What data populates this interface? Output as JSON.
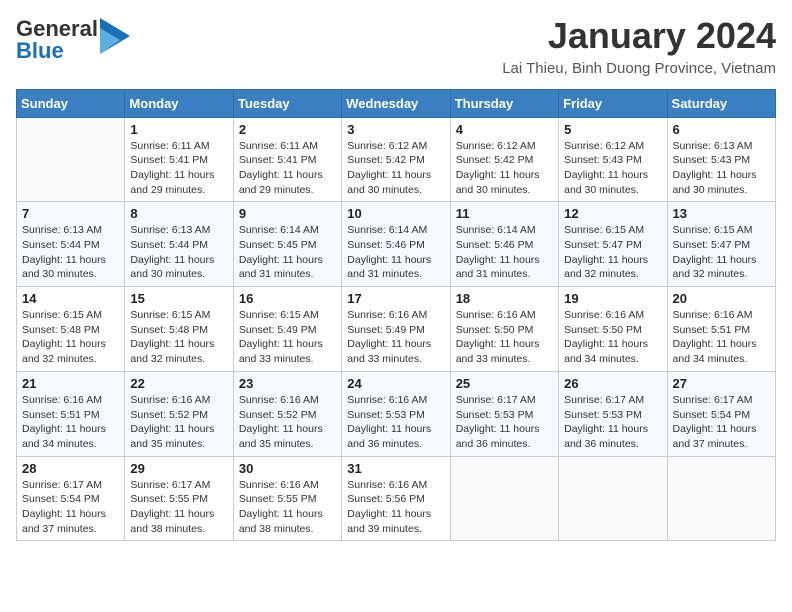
{
  "header": {
    "logo_general": "General",
    "logo_blue": "Blue",
    "month_title": "January 2024",
    "location": "Lai Thieu, Binh Duong Province, Vietnam"
  },
  "days_of_week": [
    "Sunday",
    "Monday",
    "Tuesday",
    "Wednesday",
    "Thursday",
    "Friday",
    "Saturday"
  ],
  "weeks": [
    [
      {
        "day": "",
        "sunrise": "",
        "sunset": "",
        "daylight": ""
      },
      {
        "day": "1",
        "sunrise": "Sunrise: 6:11 AM",
        "sunset": "Sunset: 5:41 PM",
        "daylight": "Daylight: 11 hours and 29 minutes."
      },
      {
        "day": "2",
        "sunrise": "Sunrise: 6:11 AM",
        "sunset": "Sunset: 5:41 PM",
        "daylight": "Daylight: 11 hours and 29 minutes."
      },
      {
        "day": "3",
        "sunrise": "Sunrise: 6:12 AM",
        "sunset": "Sunset: 5:42 PM",
        "daylight": "Daylight: 11 hours and 30 minutes."
      },
      {
        "day": "4",
        "sunrise": "Sunrise: 6:12 AM",
        "sunset": "Sunset: 5:42 PM",
        "daylight": "Daylight: 11 hours and 30 minutes."
      },
      {
        "day": "5",
        "sunrise": "Sunrise: 6:12 AM",
        "sunset": "Sunset: 5:43 PM",
        "daylight": "Daylight: 11 hours and 30 minutes."
      },
      {
        "day": "6",
        "sunrise": "Sunrise: 6:13 AM",
        "sunset": "Sunset: 5:43 PM",
        "daylight": "Daylight: 11 hours and 30 minutes."
      }
    ],
    [
      {
        "day": "7",
        "sunrise": "Sunrise: 6:13 AM",
        "sunset": "Sunset: 5:44 PM",
        "daylight": "Daylight: 11 hours and 30 minutes."
      },
      {
        "day": "8",
        "sunrise": "Sunrise: 6:13 AM",
        "sunset": "Sunset: 5:44 PM",
        "daylight": "Daylight: 11 hours and 30 minutes."
      },
      {
        "day": "9",
        "sunrise": "Sunrise: 6:14 AM",
        "sunset": "Sunset: 5:45 PM",
        "daylight": "Daylight: 11 hours and 31 minutes."
      },
      {
        "day": "10",
        "sunrise": "Sunrise: 6:14 AM",
        "sunset": "Sunset: 5:46 PM",
        "daylight": "Daylight: 11 hours and 31 minutes."
      },
      {
        "day": "11",
        "sunrise": "Sunrise: 6:14 AM",
        "sunset": "Sunset: 5:46 PM",
        "daylight": "Daylight: 11 hours and 31 minutes."
      },
      {
        "day": "12",
        "sunrise": "Sunrise: 6:15 AM",
        "sunset": "Sunset: 5:47 PM",
        "daylight": "Daylight: 11 hours and 32 minutes."
      },
      {
        "day": "13",
        "sunrise": "Sunrise: 6:15 AM",
        "sunset": "Sunset: 5:47 PM",
        "daylight": "Daylight: 11 hours and 32 minutes."
      }
    ],
    [
      {
        "day": "14",
        "sunrise": "Sunrise: 6:15 AM",
        "sunset": "Sunset: 5:48 PM",
        "daylight": "Daylight: 11 hours and 32 minutes."
      },
      {
        "day": "15",
        "sunrise": "Sunrise: 6:15 AM",
        "sunset": "Sunset: 5:48 PM",
        "daylight": "Daylight: 11 hours and 32 minutes."
      },
      {
        "day": "16",
        "sunrise": "Sunrise: 6:15 AM",
        "sunset": "Sunset: 5:49 PM",
        "daylight": "Daylight: 11 hours and 33 minutes."
      },
      {
        "day": "17",
        "sunrise": "Sunrise: 6:16 AM",
        "sunset": "Sunset: 5:49 PM",
        "daylight": "Daylight: 11 hours and 33 minutes."
      },
      {
        "day": "18",
        "sunrise": "Sunrise: 6:16 AM",
        "sunset": "Sunset: 5:50 PM",
        "daylight": "Daylight: 11 hours and 33 minutes."
      },
      {
        "day": "19",
        "sunrise": "Sunrise: 6:16 AM",
        "sunset": "Sunset: 5:50 PM",
        "daylight": "Daylight: 11 hours and 34 minutes."
      },
      {
        "day": "20",
        "sunrise": "Sunrise: 6:16 AM",
        "sunset": "Sunset: 5:51 PM",
        "daylight": "Daylight: 11 hours and 34 minutes."
      }
    ],
    [
      {
        "day": "21",
        "sunrise": "Sunrise: 6:16 AM",
        "sunset": "Sunset: 5:51 PM",
        "daylight": "Daylight: 11 hours and 34 minutes."
      },
      {
        "day": "22",
        "sunrise": "Sunrise: 6:16 AM",
        "sunset": "Sunset: 5:52 PM",
        "daylight": "Daylight: 11 hours and 35 minutes."
      },
      {
        "day": "23",
        "sunrise": "Sunrise: 6:16 AM",
        "sunset": "Sunset: 5:52 PM",
        "daylight": "Daylight: 11 hours and 35 minutes."
      },
      {
        "day": "24",
        "sunrise": "Sunrise: 6:16 AM",
        "sunset": "Sunset: 5:53 PM",
        "daylight": "Daylight: 11 hours and 36 minutes."
      },
      {
        "day": "25",
        "sunrise": "Sunrise: 6:17 AM",
        "sunset": "Sunset: 5:53 PM",
        "daylight": "Daylight: 11 hours and 36 minutes."
      },
      {
        "day": "26",
        "sunrise": "Sunrise: 6:17 AM",
        "sunset": "Sunset: 5:53 PM",
        "daylight": "Daylight: 11 hours and 36 minutes."
      },
      {
        "day": "27",
        "sunrise": "Sunrise: 6:17 AM",
        "sunset": "Sunset: 5:54 PM",
        "daylight": "Daylight: 11 hours and 37 minutes."
      }
    ],
    [
      {
        "day": "28",
        "sunrise": "Sunrise: 6:17 AM",
        "sunset": "Sunset: 5:54 PM",
        "daylight": "Daylight: 11 hours and 37 minutes."
      },
      {
        "day": "29",
        "sunrise": "Sunrise: 6:17 AM",
        "sunset": "Sunset: 5:55 PM",
        "daylight": "Daylight: 11 hours and 38 minutes."
      },
      {
        "day": "30",
        "sunrise": "Sunrise: 6:16 AM",
        "sunset": "Sunset: 5:55 PM",
        "daylight": "Daylight: 11 hours and 38 minutes."
      },
      {
        "day": "31",
        "sunrise": "Sunrise: 6:16 AM",
        "sunset": "Sunset: 5:56 PM",
        "daylight": "Daylight: 11 hours and 39 minutes."
      },
      {
        "day": "",
        "sunrise": "",
        "sunset": "",
        "daylight": ""
      },
      {
        "day": "",
        "sunrise": "",
        "sunset": "",
        "daylight": ""
      },
      {
        "day": "",
        "sunrise": "",
        "sunset": "",
        "daylight": ""
      }
    ]
  ]
}
